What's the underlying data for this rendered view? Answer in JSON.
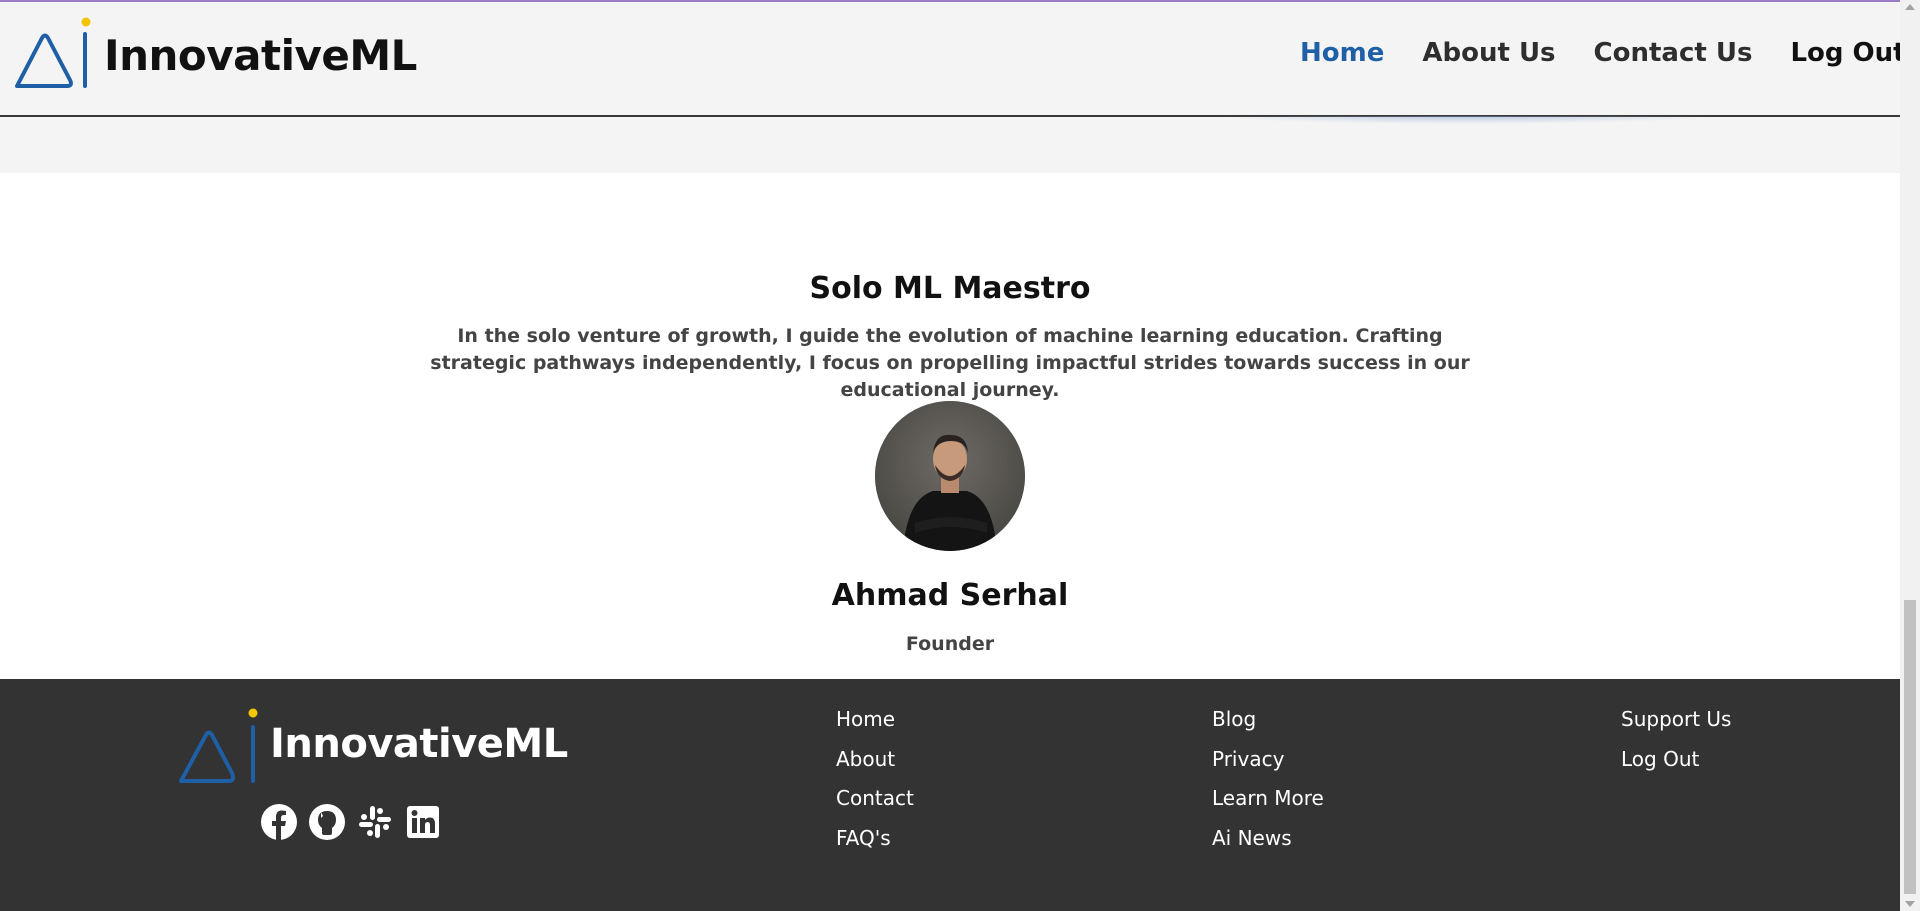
{
  "brand": {
    "name": "InnovativeML",
    "colors": {
      "logo_blue": "#1f5fa6",
      "logo_dot": "#f2c500"
    }
  },
  "nav": {
    "items": [
      {
        "label": "Home",
        "active": true
      },
      {
        "label": "About Us",
        "active": false
      },
      {
        "label": "Contact Us",
        "active": false
      },
      {
        "label": "Log Out",
        "active": false
      }
    ],
    "active_color": "#1f5fa6"
  },
  "team": {
    "title": "Solo ML Maestro",
    "description": "In the solo venture of growth, I guide the evolution of machine learning education. Crafting strategic pathways independently, I focus on propelling impactful strides towards success in our educational journey.",
    "member": {
      "name": "Ahmad Serhal",
      "role": "Founder"
    }
  },
  "footer": {
    "brand_name": "InnovativeML",
    "socials": [
      "facebook-icon",
      "github-icon",
      "slack-icon",
      "linkedin-icon"
    ],
    "columns": [
      {
        "links": [
          "Home",
          "About",
          "Contact",
          "FAQ's"
        ]
      },
      {
        "links": [
          "Blog",
          "Privacy",
          "Learn More",
          "Ai News"
        ]
      },
      {
        "links": [
          "Support Us",
          "Log Out"
        ]
      }
    ],
    "background": "#333333"
  }
}
